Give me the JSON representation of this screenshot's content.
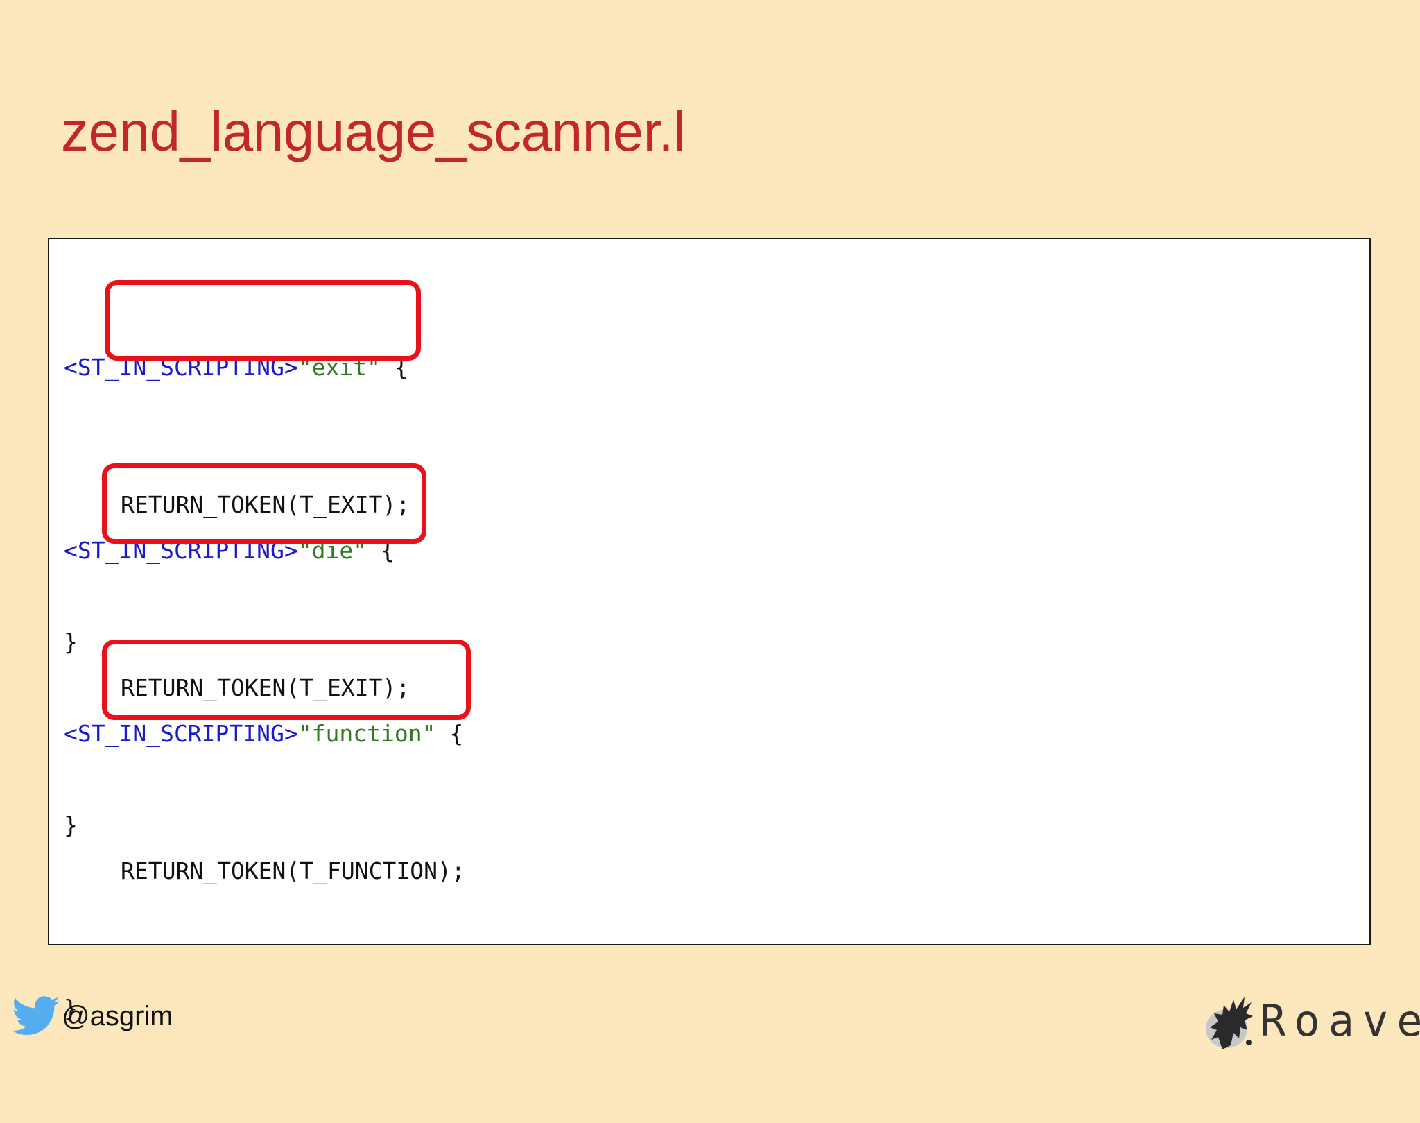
{
  "slide": {
    "title": "zend_language_scanner.l"
  },
  "code": {
    "blocks": [
      {
        "state": "<ST_IN_SCRIPTING>",
        "token_string": "\"exit\"",
        "open": " {",
        "body": "RETURN_TOKEN(T_EXIT);",
        "close": "}"
      },
      {
        "state": "<ST_IN_SCRIPTING>",
        "token_string": "\"die\"",
        "open": " {",
        "body": "RETURN_TOKEN(T_EXIT);",
        "close": "}"
      },
      {
        "state": "<ST_IN_SCRIPTING>",
        "token_string": "\"function\"",
        "open": " {",
        "body": "RETURN_TOKEN(T_FUNCTION);",
        "close": "}"
      }
    ]
  },
  "footer": {
    "handle": "@asgrim",
    "handle_icon": "twitter-bird-icon",
    "logo_text": "Roave",
    "logo_icon": "roave-logo-icon"
  },
  "colors": {
    "background": "#fde7bd",
    "title": "#c0282a",
    "highlight": "#e8131a",
    "keyword": "#1a1acc",
    "string": "#2f7a1f",
    "twitter": "#55acee"
  }
}
